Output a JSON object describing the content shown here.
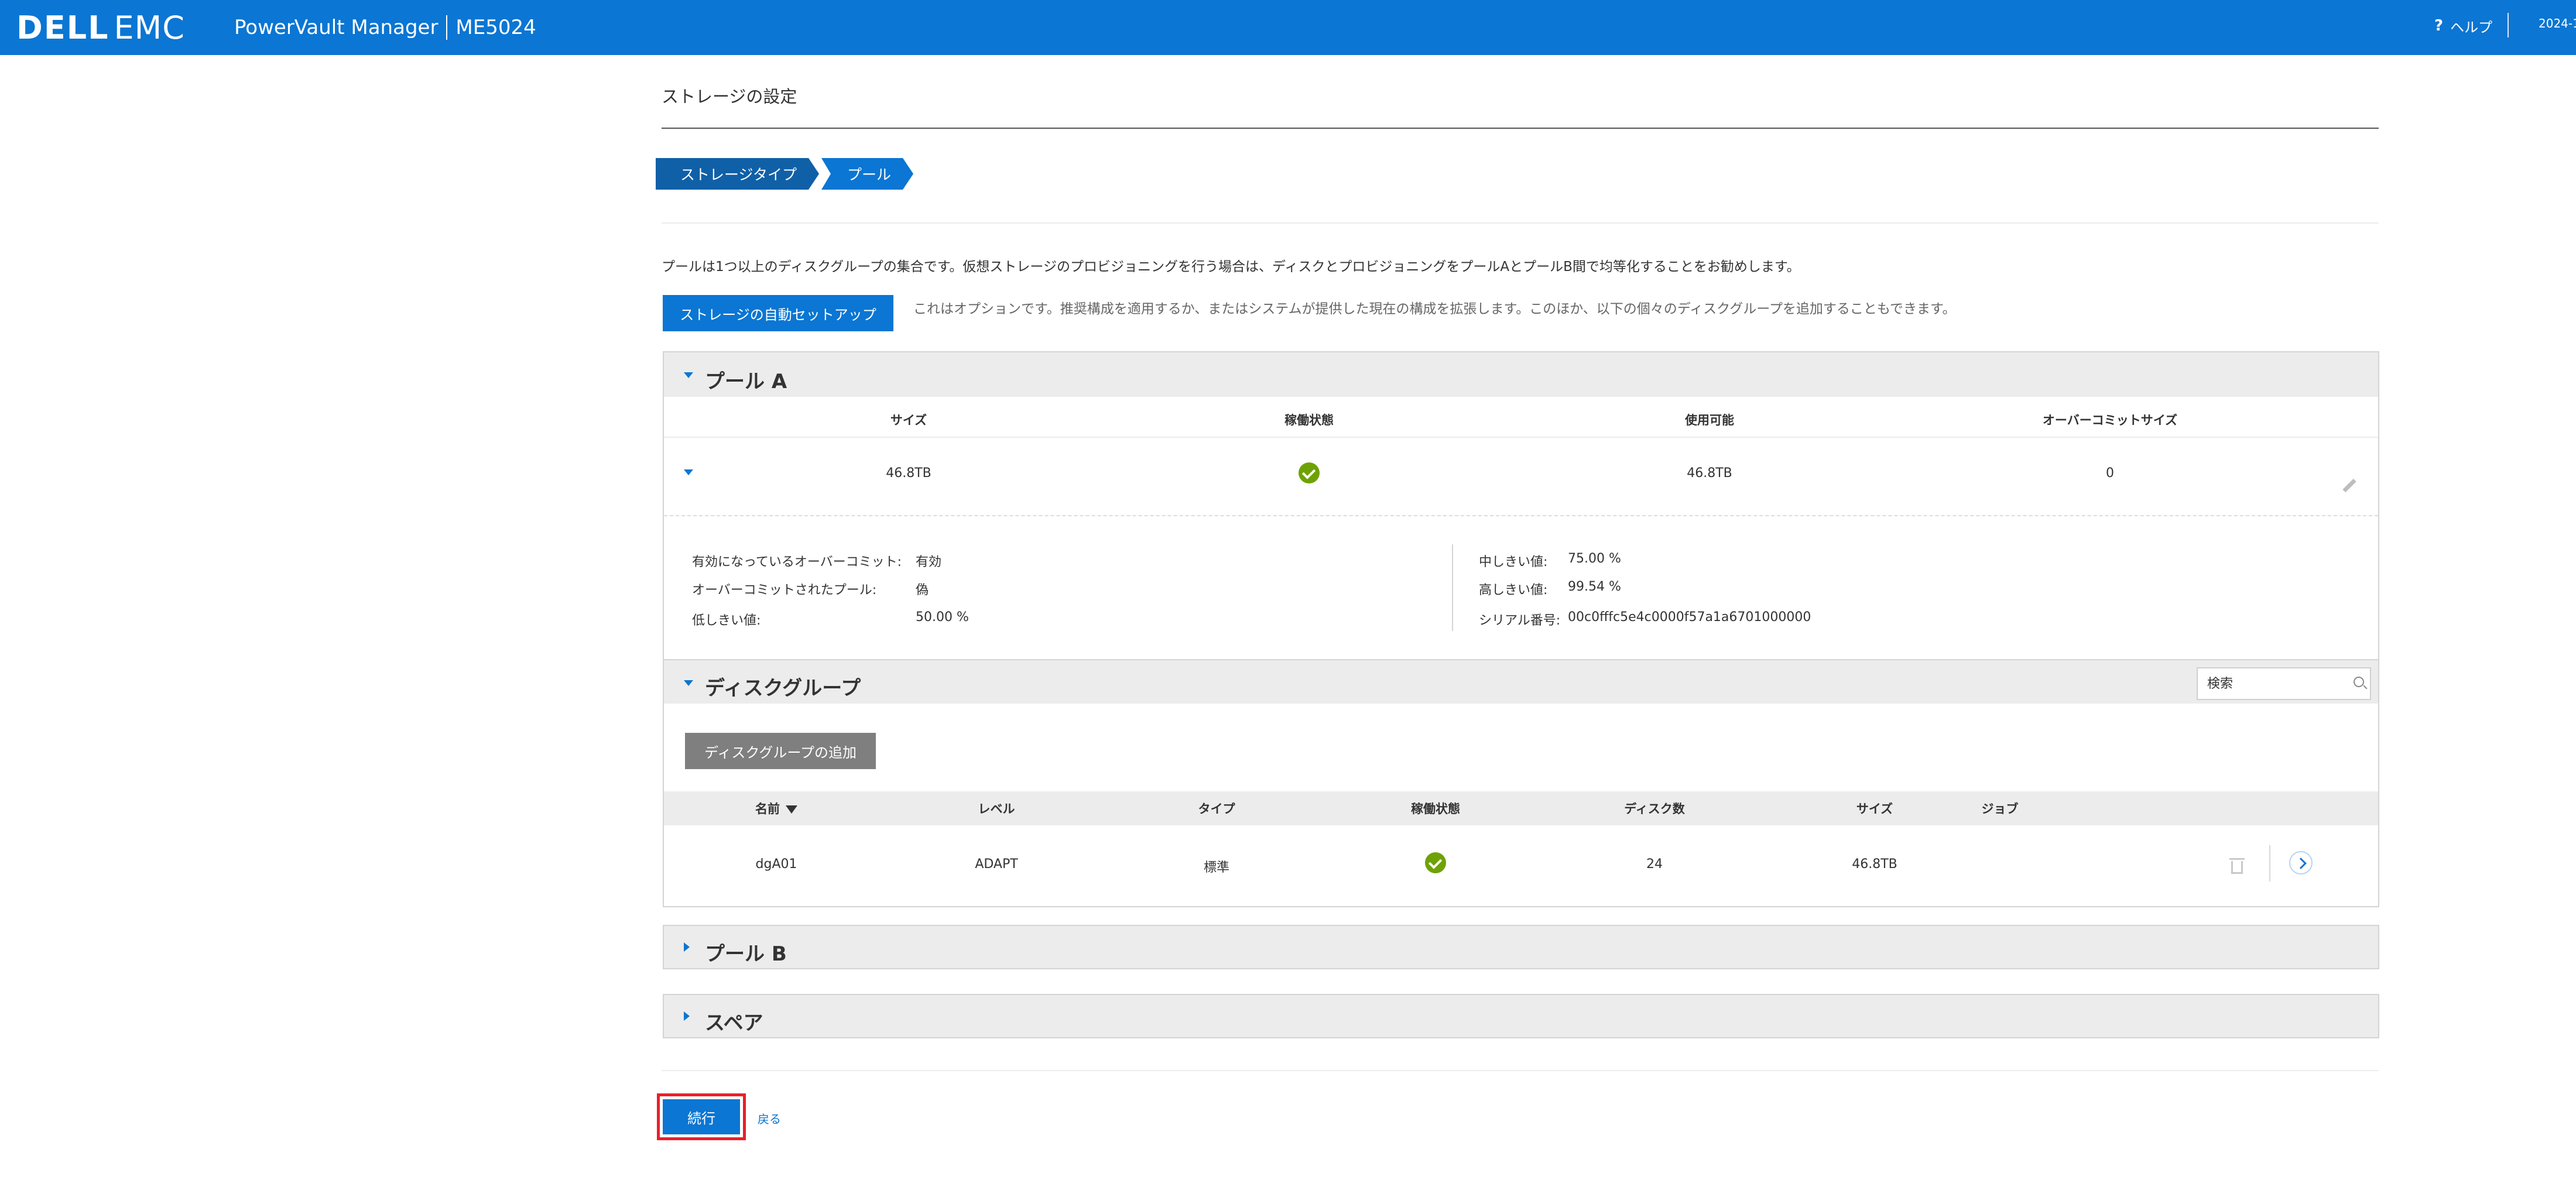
{
  "header": {
    "logo_dell": "DELL",
    "logo_emc": "EMC",
    "product": "PowerVault Manager",
    "model": "ME5024",
    "help_label": "ヘルプ",
    "date_partial": "2024-1"
  },
  "page": {
    "title": "ストレージの設定",
    "breadcrumb": [
      "ストレージタイプ",
      "プール"
    ],
    "pool_description": "プールは1つ以上のディスクグループの集合です。仮想ストレージのプロビジョニングを行う場合は、ディスクとプロビジョニングをプールAとプールB間で均等化することをお勧めします。",
    "auto_setup_button": "ストレージの自動セットアップ",
    "auto_setup_note": "これはオプションです。推奨構成を適用するか、またはシステムが提供した現在の構成を拡張します。このほか、以下の個々のディスクグループを追加することもできます。"
  },
  "poolA": {
    "title": "プール A",
    "columns": [
      "サイズ",
      "稼働状態",
      "使用可能",
      "オーバーコミットサイズ"
    ],
    "row": {
      "size": "46.8TB",
      "health": "ok",
      "available": "46.8TB",
      "overcommit_size": "0"
    },
    "details_left": [
      {
        "label": "有効になっているオーバーコミット:",
        "value": "有効"
      },
      {
        "label": "オーバーコミットされたプール:",
        "value": "偽"
      },
      {
        "label": "低しきい値:",
        "value": "50.00 %"
      }
    ],
    "details_right": [
      {
        "label": "中しきい値:",
        "value": "75.00 %"
      },
      {
        "label": "高しきい値:",
        "value": "99.54 %"
      },
      {
        "label": "シリアル番号:",
        "value": "00c0fffc5e4c0000f57a1a6701000000"
      }
    ]
  },
  "disk_groups": {
    "title": "ディスクグループ",
    "search_placeholder": "検索",
    "add_button": "ディスクグループの追加",
    "columns": [
      "名前",
      "レベル",
      "タイプ",
      "稼働状態",
      "ディスク数",
      "サイズ",
      "ジョブ"
    ],
    "rows": [
      {
        "name": "dgA01",
        "level": "ADAPT",
        "type": "標準",
        "health": "ok",
        "disks": "24",
        "size": "46.8TB",
        "job": ""
      }
    ]
  },
  "poolB": {
    "title": "プール B"
  },
  "spare": {
    "title": "スペア"
  },
  "footer": {
    "execute_button": "続行",
    "back_link": "戻る"
  },
  "colors": {
    "brand_blue": "#0b76d3",
    "health_ok": "#6ea204",
    "highlight": "#e8202a"
  }
}
